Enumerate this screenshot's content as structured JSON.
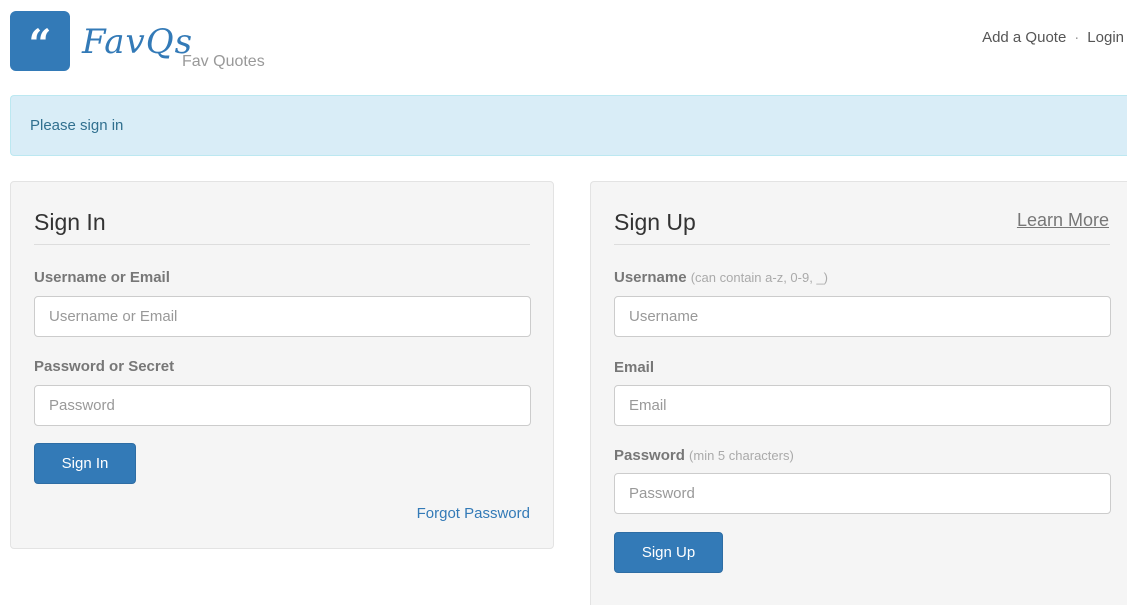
{
  "header": {
    "logo_glyph": "“",
    "brand": "FavQs",
    "tagline": "Fav Quotes",
    "nav": {
      "add_quote": "Add a Quote",
      "separator": "·",
      "login": "Login"
    }
  },
  "alert": {
    "text": "Please sign in"
  },
  "sign_in": {
    "title": "Sign In",
    "username_label": "Username or Email",
    "username_placeholder": "Username or Email",
    "password_label": "Password or Secret",
    "password_placeholder": "Password",
    "submit": "Sign In",
    "forgot": "Forgot Password"
  },
  "sign_up": {
    "title": "Sign Up",
    "learn_more": "Learn More",
    "username_label": "Username",
    "username_hint": "(can contain a-z, 0-9, _)",
    "username_placeholder": "Username",
    "email_label": "Email",
    "email_placeholder": "Email",
    "password_label": "Password",
    "password_hint": "(min 5 characters)",
    "password_placeholder": "Password",
    "submit": "Sign Up"
  },
  "colors": {
    "primary": "#337ab7",
    "alert_bg": "#d9edf7",
    "alert_text": "#31708f",
    "panel_bg": "#f5f5f5"
  }
}
